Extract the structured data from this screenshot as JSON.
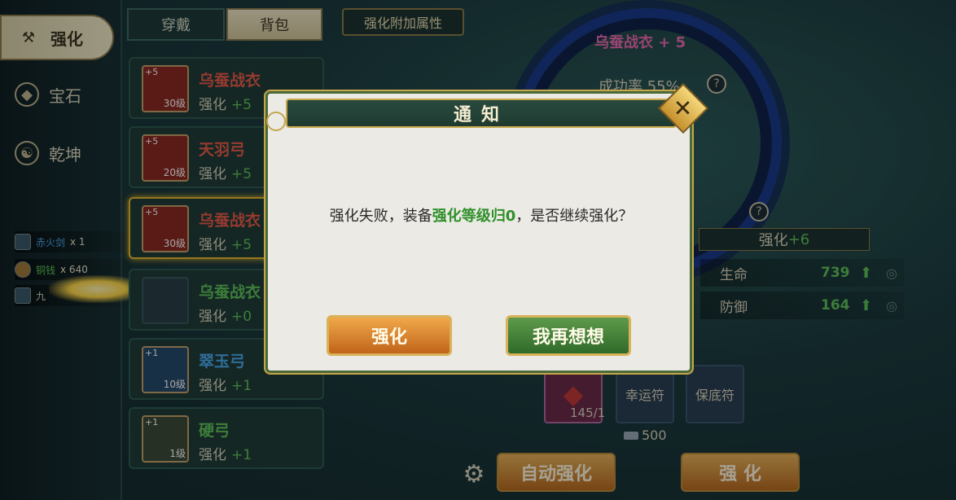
{
  "nav": {
    "items": [
      {
        "label": "强化",
        "icon": "anvil-icon"
      },
      {
        "label": "宝石",
        "icon": "gem-icon"
      },
      {
        "label": "乾坤",
        "icon": "yinyang-icon"
      }
    ]
  },
  "drops": [
    {
      "name": "赤火剑",
      "count": "x 1"
    },
    {
      "name": "铜钱",
      "count": "x 640"
    },
    {
      "name": "九",
      "count": ""
    }
  ],
  "tabs": {
    "wear": "穿戴",
    "bag": "背包",
    "extra_attr": "强化附加属性"
  },
  "equipment": [
    {
      "plus": "+5",
      "level": "30级",
      "name": "乌蚕战衣",
      "enhance_label": "强化",
      "enhance_value": "+5"
    },
    {
      "plus": "+5",
      "level": "20级",
      "name": "天羽弓",
      "enhance_label": "强化",
      "enhance_value": "+5"
    },
    {
      "plus": "+5",
      "level": "30级",
      "name": "乌蚕战衣",
      "enhance_label": "强化",
      "enhance_value": "+5"
    },
    {
      "plus": "",
      "level": "",
      "name": "乌蚕战衣",
      "enhance_label": "强化",
      "enhance_value": "+0"
    },
    {
      "plus": "+1",
      "level": "10级",
      "name": "翠玉弓",
      "enhance_label": "强化",
      "enhance_value": "+1"
    },
    {
      "plus": "+1",
      "level": "1级",
      "name": "硬弓",
      "enhance_label": "强化",
      "enhance_value": "+1"
    }
  ],
  "panel": {
    "target_name": "乌蚕战衣 + 5",
    "success_rate": "成功率 55%",
    "help_glyph": "?",
    "upgrade_label": "强化",
    "upgrade_value": "+6",
    "stats": [
      {
        "label": "生命",
        "value": "739"
      },
      {
        "label": "防御",
        "value": "164"
      }
    ],
    "material_count": "145/1",
    "lucky_charm": "幸运符",
    "guarantee_charm": "保底符",
    "cost": "500",
    "auto_enhance_button": "自动强化",
    "enhance_button": "强 化"
  },
  "dialog": {
    "title": "通知",
    "close_glyph": "✕",
    "message_prefix": "强化失败，装备",
    "message_highlight": "强化等级归0",
    "message_suffix": "，是否继续强化？",
    "confirm_button": "强化",
    "cancel_button": "我再想想"
  },
  "colors": {
    "highlight_green": "#2f8f2a",
    "stat_green": "#5ec15a",
    "item_red": "#e85a4a",
    "item_blue": "#4aa6e8",
    "gold_border": "#c6a64a"
  }
}
